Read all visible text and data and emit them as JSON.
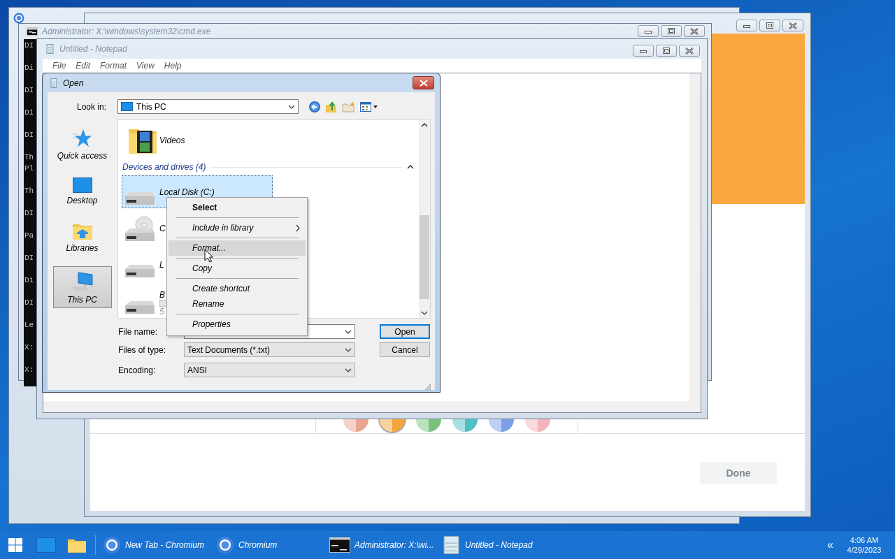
{
  "browser": {
    "swatches": [
      {
        "color": "#e9a48f",
        "selected": false
      },
      {
        "color": "#f5a53a",
        "selected": true
      },
      {
        "color": "#79c27a",
        "selected": false
      },
      {
        "color": "#4fbfc4",
        "selected": false
      },
      {
        "color": "#7b9fe8",
        "selected": false
      },
      {
        "color": "#f4b3bd",
        "selected": false
      }
    ],
    "done_button": "Done"
  },
  "console": {
    "title": "Administrator: X:\\windows\\system32\\cmd.exe",
    "paragraphs": [
      [
        "DI"
      ],
      [
        "Di"
      ],
      [
        "DI"
      ],
      [
        "Di"
      ],
      [
        "DI"
      ],
      [
        "Th",
        "Pl"
      ],
      [
        "Th"
      ],
      [
        "DI"
      ],
      [
        "Pa"
      ],
      [
        "DI"
      ],
      [
        "Di"
      ],
      [
        "DI"
      ],
      [
        "Le"
      ],
      [
        "X:"
      ],
      [
        "X:"
      ]
    ]
  },
  "notepad": {
    "title": "Untitled - Notepad",
    "menu": [
      "File",
      "Edit",
      "Format",
      "View",
      "Help"
    ]
  },
  "open_dialog": {
    "title": "Open",
    "look_in": {
      "label": "Look in:",
      "value": "This PC"
    },
    "places": [
      {
        "label": "Quick access",
        "kind": "star",
        "selected": false
      },
      {
        "label": "Desktop",
        "kind": "desktop",
        "selected": false
      },
      {
        "label": "Libraries",
        "kind": "libraries",
        "selected": false
      },
      {
        "label": "This PC",
        "kind": "pc",
        "selected": true
      }
    ],
    "folders": [
      {
        "label": "Videos",
        "kind": "videos"
      }
    ],
    "group": {
      "label": "Devices and drives (4)",
      "expanded": true
    },
    "drives": [
      {
        "label": "Local Disk (C:)",
        "kind": "disk",
        "selected": true
      },
      {
        "label": "C",
        "kind": "cd",
        "selected": false
      },
      {
        "label": "L",
        "kind": "disk",
        "selected": false
      },
      {
        "label": "B",
        "kind": "disk",
        "selected": false,
        "detail": "5"
      }
    ],
    "fields": [
      {
        "label": "File name:",
        "kind": "combo"
      },
      {
        "label": "Files of type:",
        "kind": "dropdown",
        "value": "Text Documents (*.txt)"
      },
      {
        "label": "Encoding:",
        "kind": "dropdown",
        "value": "ANSI"
      }
    ],
    "buttons": [
      {
        "label": "Open",
        "default": true
      },
      {
        "label": "Cancel",
        "default": false
      }
    ]
  },
  "context_menu": {
    "items": [
      {
        "label": "Select",
        "kind": "default",
        "selected": false
      },
      {
        "kind": "separator"
      },
      {
        "label": "Include in library",
        "kind": "submenu",
        "selected": false
      },
      {
        "kind": "separator"
      },
      {
        "label": "Format...",
        "kind": "item",
        "selected": true
      },
      {
        "kind": "separator"
      },
      {
        "label": "Copy",
        "kind": "item",
        "selected": false
      },
      {
        "kind": "separator"
      },
      {
        "label": "Create shortcut",
        "kind": "item",
        "selected": false
      },
      {
        "label": "Rename",
        "kind": "item",
        "selected": false
      },
      {
        "kind": "separator"
      },
      {
        "label": "Properties",
        "kind": "item",
        "selected": false
      }
    ]
  },
  "taskbar": {
    "items": [
      {
        "kind": "start"
      },
      {
        "kind": "desktop"
      },
      {
        "kind": "explorer"
      },
      {
        "kind": "chromium",
        "label": "New Tab - Chromium"
      },
      {
        "kind": "chromium",
        "label": "Chromium"
      },
      {
        "kind": "console",
        "label": "Administrator: X:\\wi..."
      },
      {
        "kind": "notepad",
        "label": "Untitled - Notepad"
      }
    ],
    "tray_toggle": "«",
    "time": "4:06 AM",
    "date": "4/29/2023"
  }
}
